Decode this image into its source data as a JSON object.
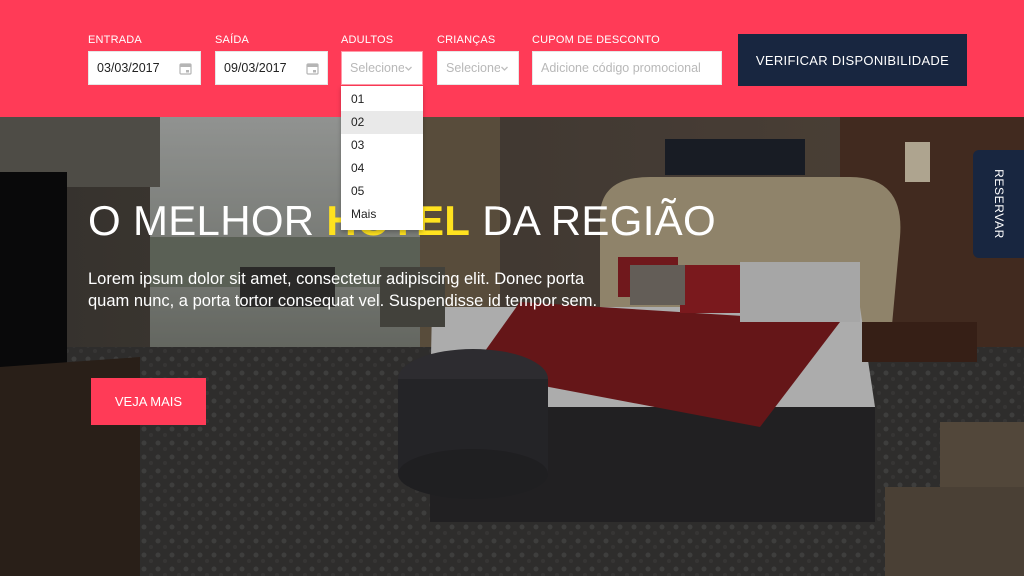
{
  "booking": {
    "checkin": {
      "label": "ENTRADA",
      "value": "03/03/2017"
    },
    "checkout": {
      "label": "SAÍDA",
      "value": "09/03/2017"
    },
    "adults": {
      "label": "ADULTOS",
      "placeholder": "Selecione",
      "options": [
        "01",
        "02",
        "03",
        "04",
        "05",
        "Mais"
      ],
      "hovered_option": "02"
    },
    "children": {
      "label": "CRIANÇAS",
      "placeholder": "Selecione"
    },
    "coupon": {
      "label": "CUPOM DE DESCONTO",
      "placeholder": "Adicione código promocional"
    },
    "submit_label": "VERIFICAR DISPONIBILIDADE"
  },
  "hero": {
    "headline_before": "O MELHOR ",
    "headline_accent": "HOTEL",
    "headline_after": " DA REGIÃO",
    "text": "Lorem ipsum dolor sit amet, consectetur adipiscing elit. Donec porta quam nunc, a porta tortor consequat vel. Suspendisse id tempor sem.",
    "cta_label": "VEJA MAIS"
  },
  "side_tab": {
    "label": "RESERVAR"
  },
  "colors": {
    "brand": "#ff3b57",
    "navy": "#182640",
    "accent": "#ffe21f"
  },
  "icons": {
    "date_field": "calendar-icon",
    "select": "chevron-down-icon"
  }
}
